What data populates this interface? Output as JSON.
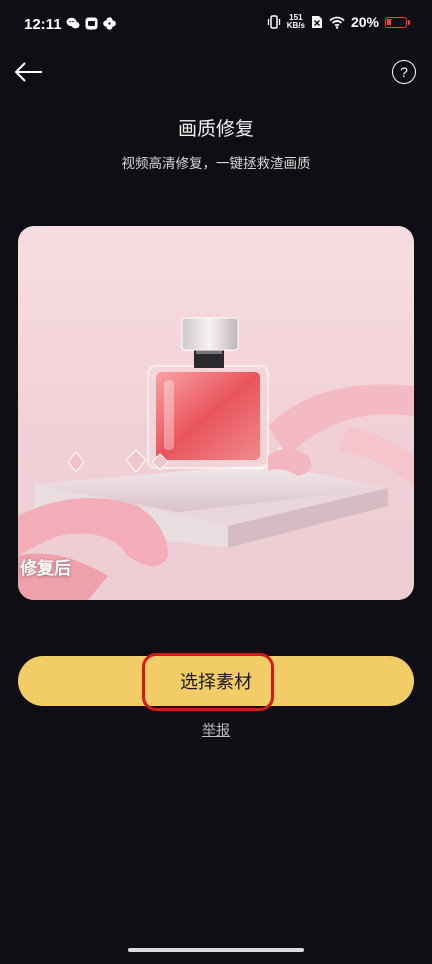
{
  "status_bar": {
    "time": "12:11",
    "net_speed_value": "151",
    "net_speed_unit": "KB/s",
    "battery_percent": "20%",
    "icons": [
      "wechat-icon",
      "app-icon",
      "fan-icon",
      "vibrate-icon",
      "no-sim-icon",
      "wifi-icon",
      "battery-icon"
    ]
  },
  "header": {
    "back_icon": "arrow-left-icon",
    "help_icon": "question-mark-icon",
    "help_symbol": "?"
  },
  "main": {
    "title": "画质修复",
    "subtitle": "视频高清修复，一键拯救渣画质",
    "preview": {
      "label": "修复后",
      "image": "perfume-bottle-with-pink-ribbons"
    },
    "select_button_label": "选择素材",
    "report_link": "举报"
  },
  "colors": {
    "background": "#0e0e14",
    "button": "#f2cc66",
    "highlight": "#d11a1a"
  }
}
